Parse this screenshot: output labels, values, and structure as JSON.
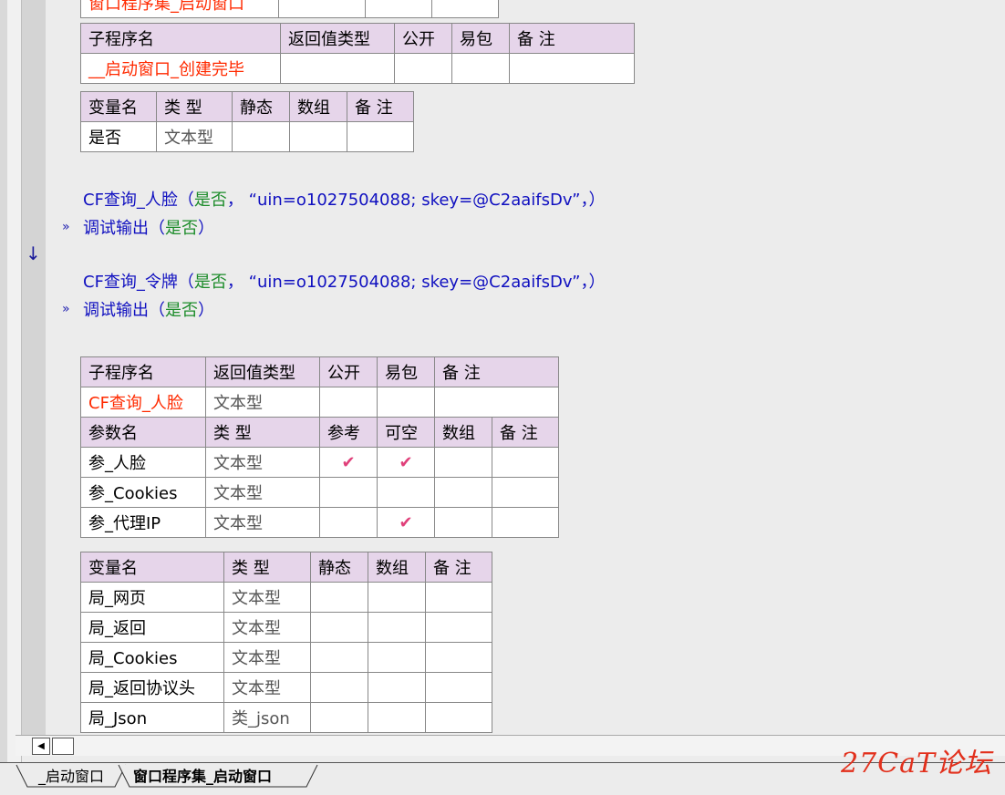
{
  "top_partial_text": "窗口程序集_启动窗口",
  "table1": {
    "headers": [
      "子程序名",
      "返回值类型",
      "公开",
      "易包",
      "备 注"
    ],
    "row": [
      "__启动窗口_创建完毕",
      "",
      "",
      "",
      ""
    ]
  },
  "table2": {
    "headers": [
      "变量名",
      "类 型",
      "静态",
      "数组",
      "备 注"
    ],
    "row": [
      "是否",
      "文本型",
      "",
      "",
      ""
    ]
  },
  "code": {
    "line1": {
      "fn": "CF查询_人脸",
      "open": "（",
      "arg1": "是否",
      "comma": "，",
      "str": "“uin=o1027504088; skey=@C2aaifsDv”",
      "close": "，）"
    },
    "line2": {
      "fn": "调试输出",
      "open": "（",
      "arg": "是否",
      "close": "）"
    },
    "line3": {
      "fn": "CF查询_令牌",
      "open": "（",
      "arg1": "是否",
      "comma": "，",
      "str": "“uin=o1027504088; skey=@C2aaifsDv”",
      "close": "，）"
    },
    "line4": {
      "fn": "调试输出",
      "open": "（",
      "arg": "是否",
      "close": "）"
    }
  },
  "table3": {
    "headers": [
      "子程序名",
      "返回值类型",
      "公开",
      "易包",
      "备 注"
    ],
    "row": [
      "CF查询_人脸",
      "文本型",
      "",
      "",
      ""
    ],
    "param_headers": [
      "参数名",
      "类 型",
      "参考",
      "可空",
      "数组",
      "备 注"
    ],
    "params": [
      [
        "参_人脸",
        "文本型",
        "✔",
        "✔",
        "",
        ""
      ],
      [
        "参_Cookies",
        "文本型",
        "",
        "",
        "",
        ""
      ],
      [
        "参_代理IP",
        "文本型",
        "",
        "✔",
        "",
        ""
      ]
    ]
  },
  "table4": {
    "headers": [
      "变量名",
      "类 型",
      "静态",
      "数组",
      "备 注"
    ],
    "rows": [
      [
        "局_网页",
        "文本型"
      ],
      [
        "局_返回",
        "文本型"
      ],
      [
        "局_Cookies",
        "文本型"
      ],
      [
        "局_返回协议头",
        "文本型"
      ],
      [
        "局_Json",
        "类_json"
      ]
    ]
  },
  "tabs": [
    "_启动窗口",
    "窗口程序集_启动窗口"
  ],
  "watermark": "27CaT论坛",
  "colors": {
    "header_bg": "#e6d5ea",
    "subname_red": "#ff2a00",
    "check_pink": "#e0407a",
    "keyword_blue": "#1010c0",
    "arg_green": "#1c8c2a"
  }
}
